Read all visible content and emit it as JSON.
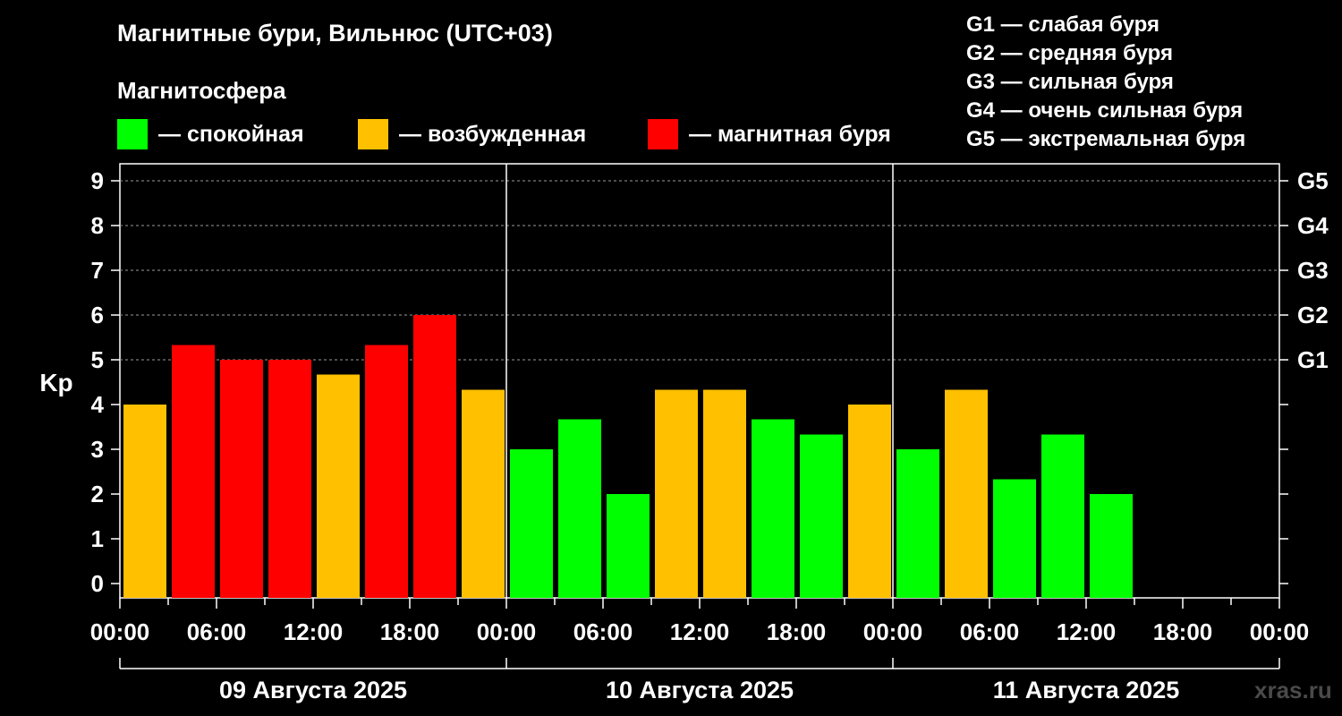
{
  "title": "Магнитные бури, Вильнюс (UTC+03)",
  "magnetosphere_label": "Магнитосфера",
  "legend": [
    {
      "label": "— спокойная",
      "color": "#00ff00"
    },
    {
      "label": "— возбужденная",
      "color": "#ffc000"
    },
    {
      "label": "— магнитная буря",
      "color": "#ff0000"
    }
  ],
  "g_legend": [
    "G1 — слабая буря",
    "G2 — средняя буря",
    "G3 — сильная буря",
    "G4 — очень сильная буря",
    "G5 — экстремальная буря"
  ],
  "watermark": "xras.ru",
  "chart_data": {
    "type": "bar",
    "ylabel": "Kp",
    "ylim": [
      0,
      9
    ],
    "yticks": [
      "0",
      "1",
      "2",
      "3",
      "4",
      "5",
      "6",
      "7",
      "8",
      "9"
    ],
    "right_ticks": [
      {
        "kp": 5,
        "label": "G1"
      },
      {
        "kp": 6,
        "label": "G2"
      },
      {
        "kp": 7,
        "label": "G3"
      },
      {
        "kp": 8,
        "label": "G4"
      },
      {
        "kp": 9,
        "label": "G5"
      }
    ],
    "x_tick_labels": [
      "00:00",
      "06:00",
      "12:00",
      "18:00",
      "00:00",
      "06:00",
      "12:00",
      "18:00",
      "00:00",
      "06:00",
      "12:00",
      "18:00",
      "00:00"
    ],
    "days": [
      "09 Августа 2025",
      "10 Августа 2025",
      "11 Августа 2025"
    ],
    "grid": "dashed horizontal at Kp 5–9",
    "values": [
      4.0,
      5.33,
      5.0,
      5.0,
      4.67,
      5.33,
      6.0,
      4.33,
      3.0,
      3.67,
      2.0,
      4.33,
      4.33,
      3.67,
      3.33,
      4.0,
      3.0,
      4.33,
      2.33,
      3.33,
      2.0
    ],
    "bar_colors": [
      "#ffc000",
      "#ff0000",
      "#ff0000",
      "#ff0000",
      "#ffc000",
      "#ff0000",
      "#ff0000",
      "#ffc000",
      "#00ff00",
      "#00ff00",
      "#00ff00",
      "#ffc000",
      "#ffc000",
      "#00ff00",
      "#00ff00",
      "#ffc000",
      "#00ff00",
      "#ffc000",
      "#00ff00",
      "#00ff00",
      "#00ff00"
    ]
  }
}
